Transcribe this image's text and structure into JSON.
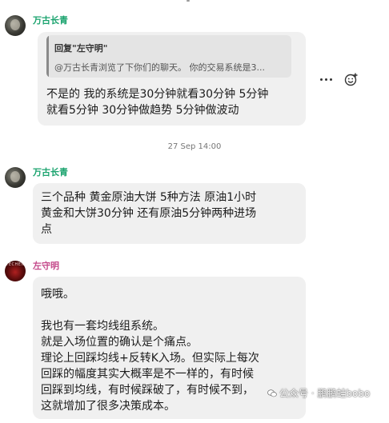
{
  "messages": [
    {
      "sender": "万古长青",
      "sender_color": "#1aa36e",
      "quote": {
        "title": "回复\"左守明\"",
        "body": "@万古长青浏览了下你们的聊天。 你的交易系统是3..."
      },
      "text": "不是的  我的系统是30分钟就看30分钟  5分钟\n就看5分钟  30分钟做趋势 5分钟做波动"
    },
    {
      "sender": "万古长青",
      "sender_color": "#1aa36e",
      "text": "三个品种 黄金原油大饼 5种方法 原油1小时\n黄金和大饼30分钟 还有原油5分钟两种进场\n点"
    },
    {
      "sender": "左守明",
      "sender_color": "#c4488a",
      "avatar_text": "TECHEN",
      "text": "哦哦。\n\n我也有一套均线组系统。\n就是入场位置的确认是个痛点。\n理论上回踩均线+反转K入场。但实际上每次\n回踩的幅度其实大概率是不一样的，有时候\n回踩到均线，有时候踩破了，有时候不到，\n这就增加了很多决策成本。"
    }
  ],
  "date_separator": "27 Sep 14:00",
  "icons": {
    "more": "more-horizontal-icon",
    "react": "add-emoji-icon",
    "watermark": "wechat-icon"
  },
  "watermark": "公众号 · 鹏鹏蛙bobo"
}
